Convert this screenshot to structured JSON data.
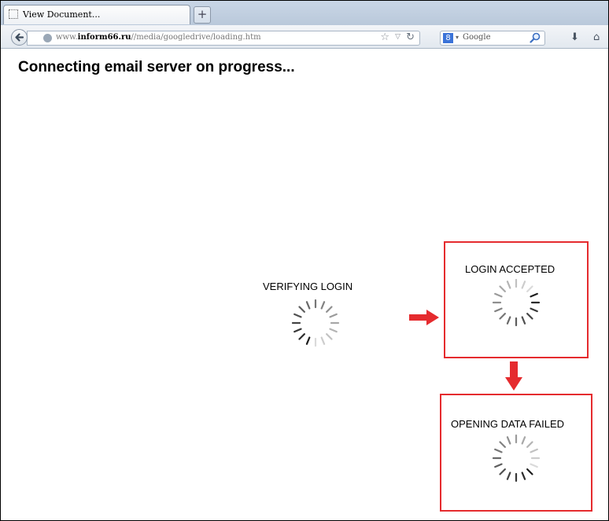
{
  "browser": {
    "tab_title": "View Document...",
    "new_tab_symbol": "+",
    "url_prefix": "www.",
    "url_domain": "inform66.ru",
    "url_path": "//media/googledrive/loading.htm",
    "search_engine_badge": "8",
    "search_placeholder": "Google"
  },
  "page": {
    "heading": "Connecting email server on progress...",
    "steps": [
      {
        "label": "VERIFYING LOGIN"
      },
      {
        "label": "LOGIN ACCEPTED"
      },
      {
        "label": "OPENING DATA FAILED"
      }
    ]
  },
  "colors": {
    "box_border": "#e52b2e",
    "arrow": "#e52b2e"
  },
  "icons": [
    "back-icon",
    "globe-icon",
    "star-icon",
    "reload-icon",
    "google-icon",
    "search-icon",
    "download-icon",
    "home-icon",
    "spinner-icon",
    "arrow-right-icon",
    "arrow-down-icon"
  ]
}
